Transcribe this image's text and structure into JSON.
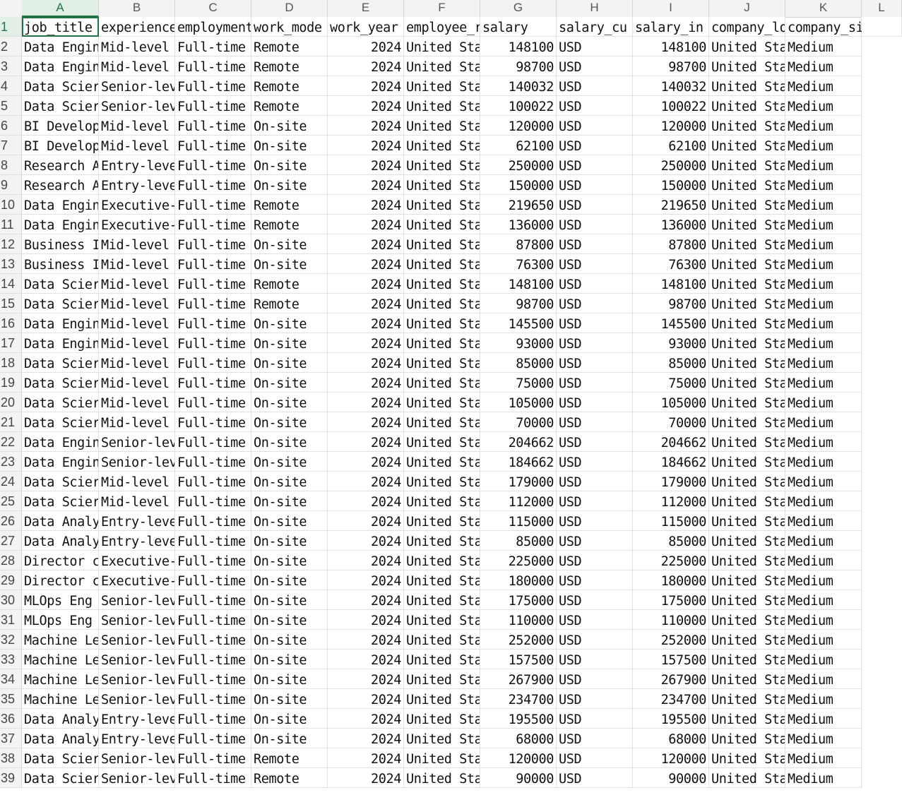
{
  "columns": [
    "A",
    "B",
    "C",
    "D",
    "E",
    "F",
    "G",
    "H",
    "I",
    "J",
    "K",
    "L"
  ],
  "headers": [
    "job_title",
    "experience",
    "employment",
    "work_mode",
    "work_year",
    "employee_r",
    "salary",
    "salary_cu",
    "salary_in",
    "company_lo",
    "company_size",
    ""
  ],
  "rows": [
    [
      "Data Engin",
      "Mid-level",
      "Full-time",
      "Remote",
      "2024",
      "United Sta",
      "148100",
      "USD",
      "148100",
      "United Sta",
      "Medium"
    ],
    [
      "Data Engin",
      "Mid-level",
      "Full-time",
      "Remote",
      "2024",
      "United Sta",
      "98700",
      "USD",
      "98700",
      "United Sta",
      "Medium"
    ],
    [
      "Data Scier",
      "Senior-lev",
      "Full-time",
      "Remote",
      "2024",
      "United Sta",
      "140032",
      "USD",
      "140032",
      "United Sta",
      "Medium"
    ],
    [
      "Data Scier",
      "Senior-lev",
      "Full-time",
      "Remote",
      "2024",
      "United Sta",
      "100022",
      "USD",
      "100022",
      "United Sta",
      "Medium"
    ],
    [
      "BI Develop",
      "Mid-level",
      "Full-time",
      "On-site",
      "2024",
      "United Sta",
      "120000",
      "USD",
      "120000",
      "United Sta",
      "Medium"
    ],
    [
      "BI Develop",
      "Mid-level",
      "Full-time",
      "On-site",
      "2024",
      "United Sta",
      "62100",
      "USD",
      "62100",
      "United Sta",
      "Medium"
    ],
    [
      "Research A",
      "Entry-leve",
      "Full-time",
      "On-site",
      "2024",
      "United Sta",
      "250000",
      "USD",
      "250000",
      "United Sta",
      "Medium"
    ],
    [
      "Research A",
      "Entry-leve",
      "Full-time",
      "On-site",
      "2024",
      "United Sta",
      "150000",
      "USD",
      "150000",
      "United Sta",
      "Medium"
    ],
    [
      "Data Engin",
      "Executive-",
      "Full-time",
      "Remote",
      "2024",
      "United Sta",
      "219650",
      "USD",
      "219650",
      "United Sta",
      "Medium"
    ],
    [
      "Data Engin",
      "Executive-",
      "Full-time",
      "Remote",
      "2024",
      "United Sta",
      "136000",
      "USD",
      "136000",
      "United Sta",
      "Medium"
    ],
    [
      "Business I",
      "Mid-level",
      "Full-time",
      "On-site",
      "2024",
      "United Sta",
      "87800",
      "USD",
      "87800",
      "United Sta",
      "Medium"
    ],
    [
      "Business I",
      "Mid-level",
      "Full-time",
      "On-site",
      "2024",
      "United Sta",
      "76300",
      "USD",
      "76300",
      "United Sta",
      "Medium"
    ],
    [
      "Data Scier",
      "Mid-level",
      "Full-time",
      "Remote",
      "2024",
      "United Sta",
      "148100",
      "USD",
      "148100",
      "United Sta",
      "Medium"
    ],
    [
      "Data Scier",
      "Mid-level",
      "Full-time",
      "Remote",
      "2024",
      "United Sta",
      "98700",
      "USD",
      "98700",
      "United Sta",
      "Medium"
    ],
    [
      "Data Engin",
      "Mid-level",
      "Full-time",
      "On-site",
      "2024",
      "United Sta",
      "145500",
      "USD",
      "145500",
      "United Sta",
      "Medium"
    ],
    [
      "Data Engin",
      "Mid-level",
      "Full-time",
      "On-site",
      "2024",
      "United Sta",
      "93000",
      "USD",
      "93000",
      "United Sta",
      "Medium"
    ],
    [
      "Data Scier",
      "Mid-level",
      "Full-time",
      "On-site",
      "2024",
      "United Sta",
      "85000",
      "USD",
      "85000",
      "United Sta",
      "Medium"
    ],
    [
      "Data Scier",
      "Mid-level",
      "Full-time",
      "On-site",
      "2024",
      "United Sta",
      "75000",
      "USD",
      "75000",
      "United Sta",
      "Medium"
    ],
    [
      "Data Scier",
      "Mid-level",
      "Full-time",
      "On-site",
      "2024",
      "United Sta",
      "105000",
      "USD",
      "105000",
      "United Sta",
      "Medium"
    ],
    [
      "Data Scier",
      "Mid-level",
      "Full-time",
      "On-site",
      "2024",
      "United Sta",
      "70000",
      "USD",
      "70000",
      "United Sta",
      "Medium"
    ],
    [
      "Data Engin",
      "Senior-lev",
      "Full-time",
      "On-site",
      "2024",
      "United Sta",
      "204662",
      "USD",
      "204662",
      "United Sta",
      "Medium"
    ],
    [
      "Data Engin",
      "Senior-lev",
      "Full-time",
      "On-site",
      "2024",
      "United Sta",
      "184662",
      "USD",
      "184662",
      "United Sta",
      "Medium"
    ],
    [
      "Data Scier",
      "Mid-level",
      "Full-time",
      "On-site",
      "2024",
      "United Sta",
      "179000",
      "USD",
      "179000",
      "United Sta",
      "Medium"
    ],
    [
      "Data Scier",
      "Mid-level",
      "Full-time",
      "On-site",
      "2024",
      "United Sta",
      "112000",
      "USD",
      "112000",
      "United Sta",
      "Medium"
    ],
    [
      "Data Analy",
      "Entry-leve",
      "Full-time",
      "On-site",
      "2024",
      "United Sta",
      "115000",
      "USD",
      "115000",
      "United Sta",
      "Medium"
    ],
    [
      "Data Analy",
      "Entry-leve",
      "Full-time",
      "On-site",
      "2024",
      "United Sta",
      "85000",
      "USD",
      "85000",
      "United Sta",
      "Medium"
    ],
    [
      "Director c",
      "Executive-",
      "Full-time",
      "On-site",
      "2024",
      "United Sta",
      "225000",
      "USD",
      "225000",
      "United Sta",
      "Medium"
    ],
    [
      "Director c",
      "Executive-",
      "Full-time",
      "On-site",
      "2024",
      "United Sta",
      "180000",
      "USD",
      "180000",
      "United Sta",
      "Medium"
    ],
    [
      "MLOps Eng",
      "Senior-lev",
      "Full-time",
      "On-site",
      "2024",
      "United Sta",
      "175000",
      "USD",
      "175000",
      "United Sta",
      "Medium"
    ],
    [
      "MLOps Eng",
      "Senior-lev",
      "Full-time",
      "On-site",
      "2024",
      "United Sta",
      "110000",
      "USD",
      "110000",
      "United Sta",
      "Medium"
    ],
    [
      "Machine Le",
      "Senior-lev",
      "Full-time",
      "On-site",
      "2024",
      "United Sta",
      "252000",
      "USD",
      "252000",
      "United Sta",
      "Medium"
    ],
    [
      "Machine Le",
      "Senior-lev",
      "Full-time",
      "On-site",
      "2024",
      "United Sta",
      "157500",
      "USD",
      "157500",
      "United Sta",
      "Medium"
    ],
    [
      "Machine Le",
      "Senior-lev",
      "Full-time",
      "On-site",
      "2024",
      "United Sta",
      "267900",
      "USD",
      "267900",
      "United Sta",
      "Medium"
    ],
    [
      "Machine Le",
      "Senior-lev",
      "Full-time",
      "On-site",
      "2024",
      "United Sta",
      "234700",
      "USD",
      "234700",
      "United Sta",
      "Medium"
    ],
    [
      "Data Analy",
      "Entry-leve",
      "Full-time",
      "On-site",
      "2024",
      "United Sta",
      "195500",
      "USD",
      "195500",
      "United Sta",
      "Medium"
    ],
    [
      "Data Analy",
      "Entry-leve",
      "Full-time",
      "On-site",
      "2024",
      "United Sta",
      "68000",
      "USD",
      "68000",
      "United Sta",
      "Medium"
    ],
    [
      "Data Scier",
      "Senior-lev",
      "Full-time",
      "Remote",
      "2024",
      "United Sta",
      "120000",
      "USD",
      "120000",
      "United Sta",
      "Medium"
    ],
    [
      "Data Scier",
      "Senior-lev",
      "Full-time",
      "Remote",
      "2024",
      "United Sta",
      "90000",
      "USD",
      "90000",
      "United Sta",
      "Medium"
    ]
  ]
}
